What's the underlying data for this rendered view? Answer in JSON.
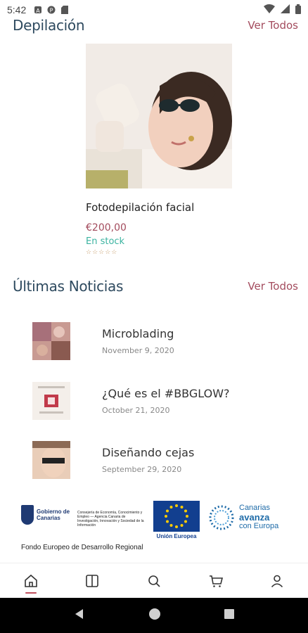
{
  "status_bar": {
    "time": "5:42"
  },
  "depilacion": {
    "title": "Depilación",
    "see_all": "Ver Todos",
    "product": {
      "name": "Fotodepilación facial",
      "price": "€200,00",
      "stock": "En stock",
      "stars": "☆☆☆☆☆",
      "rating": 0
    }
  },
  "news": {
    "title": "Últimas Noticias",
    "see_all": "Ver Todos",
    "items": [
      {
        "title": "Microblading",
        "date": "November 9, 2020"
      },
      {
        "title": "¿Qué es el #BBGLOW?",
        "date": "October 21, 2020"
      },
      {
        "title": "Diseñando cejas",
        "date": "September 29, 2020"
      }
    ]
  },
  "footer_logos": {
    "gobierno": "Gobierno de Canarias",
    "consejeria": "Consejería de Economía, Conocimiento y Empleo — Agencia Canaria de Investigación, Innovación y Sociedad de la Información",
    "eu": "Unión Europea",
    "canarias_line1": "Canarias",
    "canarias_line2": "avanza",
    "canarias_line3": "con Europa",
    "fondo": "Fondo Europeo de Desarrollo Regional"
  },
  "bottom_nav": {
    "items": [
      "home-icon",
      "book-icon",
      "search-icon",
      "cart-icon",
      "user-icon"
    ],
    "active_color": "#c0505d"
  },
  "colors": {
    "title": "#2e4a5f",
    "accent": "#a34b5d",
    "stock": "#3bb3a0"
  }
}
